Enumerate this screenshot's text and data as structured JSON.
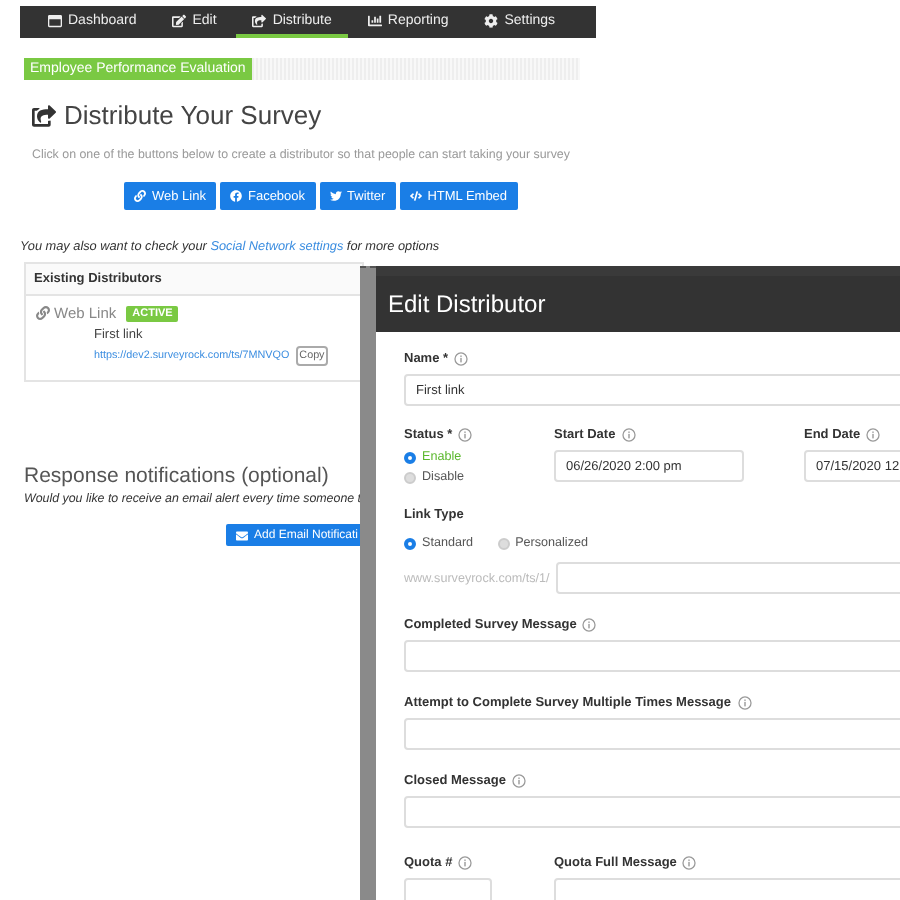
{
  "nav": [
    {
      "label": "Dashboard",
      "kind": "dashboard",
      "selected": false
    },
    {
      "label": "Edit",
      "kind": "edit",
      "selected": false
    },
    {
      "label": "Distribute",
      "kind": "share",
      "selected": true
    },
    {
      "label": "Reporting",
      "kind": "chart",
      "selected": false
    },
    {
      "label": "Settings",
      "kind": "gear",
      "selected": false
    }
  ],
  "survey_title": "Employee Performance Evaluation",
  "heading": "Distribute Your Survey",
  "intro": "Click on one of the buttons below to create a distributor so that people can start taking your survey",
  "share_buttons": [
    {
      "label": "Web Link",
      "kind": "link"
    },
    {
      "label": "Facebook",
      "kind": "facebook"
    },
    {
      "label": "Twitter",
      "kind": "twitter"
    },
    {
      "label": "HTML Embed",
      "kind": "code"
    }
  ],
  "note": {
    "before": "You may also want to check your",
    "link": "Social Network settings",
    "after": "for more options"
  },
  "distributors": {
    "title": "Existing Distributors",
    "items": [
      {
        "type": "Web Link",
        "status": "ACTIVE",
        "name": "First link",
        "url": "https://dev2.surveyrock.com/ts/7MNVQO",
        "copy": "Copy"
      }
    ]
  },
  "notifications": {
    "title": "Response notifications (optional)",
    "text": "Would you like to receive an email alert every time someone t",
    "button": "Add Email Notificati"
  },
  "modal": {
    "title": "Edit Distributor",
    "name": {
      "label": "Name *",
      "value": "First link"
    },
    "status": {
      "label": "Status *",
      "options": [
        {
          "label": "Enable",
          "selected": true
        },
        {
          "label": "Disable",
          "selected": false
        }
      ]
    },
    "start_date": {
      "label": "Start Date",
      "value": "06/26/2020 2:00 pm"
    },
    "end_date": {
      "label": "End Date",
      "value": "07/15/2020 12"
    },
    "link_type": {
      "label": "Link Type",
      "options": [
        {
          "label": "Standard",
          "selected": true
        },
        {
          "label": "Personalized",
          "selected": false
        }
      ]
    },
    "url_prefix": "www.surveyrock.com/ts/1/",
    "messages": [
      {
        "label": "Completed Survey Message"
      },
      {
        "label": "Attempt to Complete Survey Multiple Times Message"
      },
      {
        "label": "Closed Message"
      }
    ],
    "quota": {
      "label": "Quota #"
    },
    "quota_full": {
      "label": "Quota Full Message"
    }
  }
}
